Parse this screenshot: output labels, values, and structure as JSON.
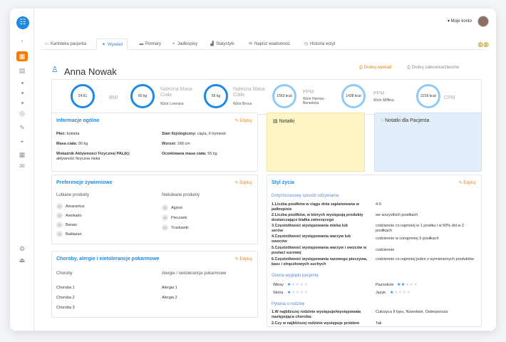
{
  "app": {
    "logo": "☷"
  },
  "topbar": {
    "account_label": "Moje konto"
  },
  "tabs": [
    {
      "label": "Kartoteka pacjenta",
      "icon": "folder-icon"
    },
    {
      "label": "Wywiad",
      "icon": "pin-icon"
    },
    {
      "label": "Pomiary",
      "icon": "measure-icon"
    },
    {
      "label": "Jadłospisy",
      "icon": "dish-icon"
    },
    {
      "label": "Statystyki",
      "icon": "chart-icon"
    },
    {
      "label": "Napisz wiadomość",
      "icon": "mail-icon"
    },
    {
      "label": "Historia wizyt",
      "icon": "history-icon"
    }
  ],
  "patient": {
    "name": "Anna Nowak"
  },
  "actions": {
    "print_interview": "Drukuj wywiad",
    "print_recommendations": "Drukuj zalecenia/zlecone"
  },
  "stats": {
    "bmi": {
      "value": "24.61",
      "label": "BMI"
    },
    "weight_lorentz": {
      "value": "60 kg",
      "label": "Należna Masa Ciała",
      "sub": "Wzór Lorentza"
    },
    "weight_broca": {
      "value": "55 kg",
      "label": "Należna Masa Ciała",
      "sub": "Wzór Broca"
    },
    "ppm_harris": {
      "value": "1563 kcal",
      "label": "PPM",
      "sub": "Wzór Harrisa -Benedicta"
    },
    "ppm_mifflin": {
      "value": "1438 kcal",
      "label": "PPM",
      "sub": "Wzór Mifflina"
    },
    "cpm": {
      "value": "2216 kcal",
      "label": "CPM"
    }
  },
  "edit_label": "Edytuj",
  "general": {
    "title": "Informacje ogólne",
    "sex_label": "Płeć:",
    "sex": "kobieta",
    "physio_label": "Stan fizjologiczny:",
    "physio": "ciąża, II trymestr",
    "weight_label": "Masa ciała:",
    "weight": "90 kg",
    "height_label": "Wzrost:",
    "height": "168 cm",
    "pal_label": "Wskaźnik Aktywności Fizycznej PAL(k):",
    "pal": "aktywność fizyczna niska",
    "expected_label": "Oczekiwana masa ciała:",
    "expected": "55 kg"
  },
  "notes": {
    "title": "Notatki",
    "patient_title": "Notatki dla Pacjenta"
  },
  "preferences": {
    "title": "Preferencje żywieniowe",
    "liked_title": "Lubiane produkty",
    "disliked_title": "Nielubiane produkty",
    "liked": [
      "Amarantus",
      "Awokado",
      "Banan",
      "Bakłażan"
    ],
    "disliked": [
      "Agrest",
      "Pieczarki",
      "Truskawki"
    ]
  },
  "diseases": {
    "title": "Choroby, alergie i nietolerancje pokarmowe",
    "col1": "Choroby",
    "col2": "Alergie / nietolerancje pokarmowe",
    "diseases": [
      "Choroba 1",
      "Choroba 2",
      "Choroba 3"
    ],
    "allergies": [
      "Alergia 1",
      "Alergia 2"
    ]
  },
  "lifestyle": {
    "title": "Styl życia",
    "habits_title": "Dotychczasowy sposób odżywiania",
    "habits": [
      {
        "q": "1.Liczba posiłków w ciągu dnia zaplanowana w jadłospisie",
        "a": "4-5"
      },
      {
        "q": "2.Liczba posiłków, w których występują produkty dostarczające białka zwierzęcego",
        "a": "we wszystkich posiłkach"
      },
      {
        "q": "3.Częstotliwość występowania mleka lub serów",
        "a": "codziennie co najmniej w 1 posiłku i w 50% dni w 2 posiłkach"
      },
      {
        "q": "4.Częstotliwość występowania warzyw lub owoców",
        "a": "codziennie w conajmniej 3 posiłkach"
      },
      {
        "q": "5.Częstotliwość występowania warzyw i owoców w postaci surowej",
        "a": "codziennie"
      },
      {
        "q": "6.Częstotliwość występowania razowego pieczywa, kasz i strączkowych suchych",
        "a": "codziennie co najmniej jeden z wymienionych produktów"
      }
    ],
    "appearance_title": "Ocena wyglądu pacjenta",
    "ratings": [
      {
        "label": "Włosy",
        "value": 1
      },
      {
        "label": "Paznokcie",
        "value": 2
      },
      {
        "label": "Skóra",
        "value": 1
      },
      {
        "label": "Język",
        "value": 1
      }
    ],
    "family_title": "Pytania o rodzinę",
    "family": [
      {
        "q": "1.W najbliższej rodzinie występuje/występowała następująca choroba:",
        "a": "Cukrzyca II typu, Nowotwór, Osteoporoza"
      },
      {
        "q": "2.Czy w najbliższej rodzinie występuje problem",
        "a": "Tak"
      }
    ]
  }
}
